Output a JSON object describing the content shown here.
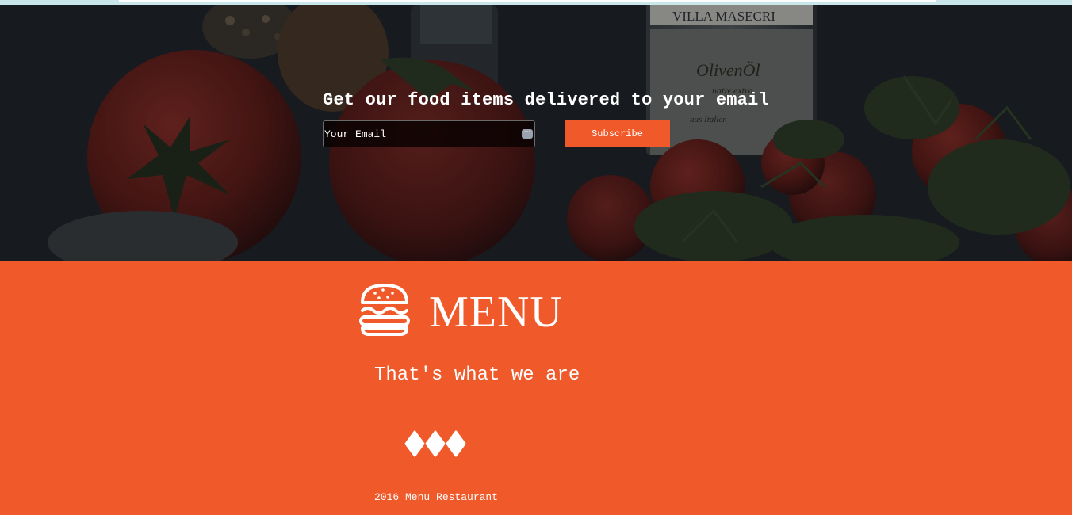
{
  "hero": {
    "background_image": "food-ingredients-photo",
    "headline": "Get our food items delivered to your email",
    "email_placeholder": "Your Email",
    "email_value": "",
    "autofill_icon": "ellipsis-icon",
    "subscribe_label": "Subscribe"
  },
  "menu_section": {
    "logo_icon": "burger-icon",
    "brand_name": "MENU",
    "tagline": "That's what we are",
    "divider_icon": "diamonds-icon",
    "footer": "2016 Menu Restaurant"
  },
  "colors": {
    "accent": "#f05a2a",
    "hero_overlay": "#1d2024",
    "text": "#ffffff",
    "top_strip": "#c9e6ea"
  }
}
